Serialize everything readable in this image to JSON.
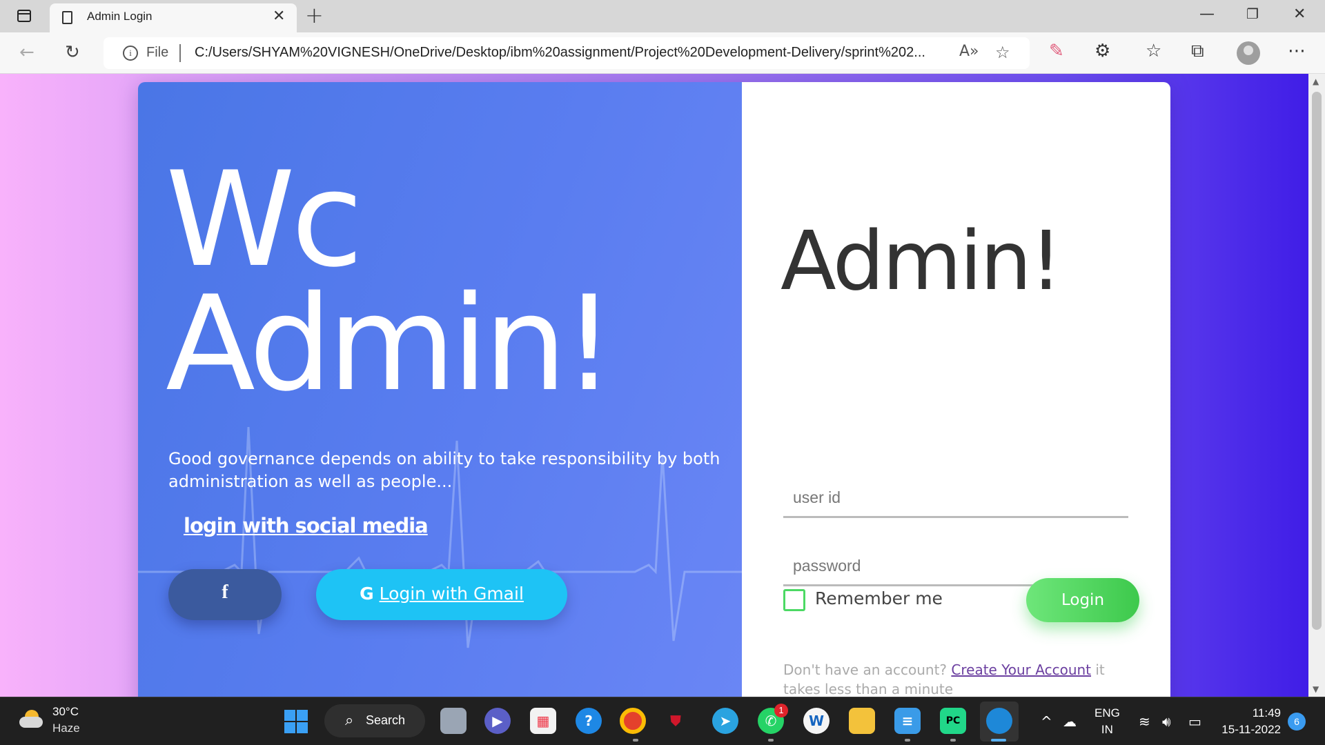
{
  "browser": {
    "tab_title": "Admin Login",
    "address": {
      "scheme_label": "File",
      "url": "C:/Users/SHYAM%20VIGNESH/OneDrive/Desktop/ibm%20assignment/Project%20Development-Delivery/sprint%202..."
    }
  },
  "hero": {
    "title_line1": "Wc",
    "title_line2": "Admin!",
    "tagline": "Good governance depends on ability to take responsibility by both administration as well as people...",
    "social_link": "login with social media",
    "facebook_label": "f",
    "gmail_g": "G",
    "gmail_label": "Login with Gmail"
  },
  "login": {
    "title": "Admin!",
    "userid_placeholder": "user id",
    "password_placeholder": "password",
    "remember_label": "Remember me",
    "login_button": "Login",
    "signup_text_before": "Don't have an account?",
    "signup_link": "Create Your Account",
    "signup_text_after": "it takes less than a minute"
  },
  "taskbar": {
    "weather_temp": "30°C",
    "weather_cond": "Haze",
    "search_label": "Search",
    "whatsapp_badge": "1",
    "lang_line1": "ENG",
    "lang_line2": "IN",
    "time": "11:49",
    "date": "15-11-2022",
    "notifications": "6"
  },
  "colors": {
    "hero_blue": "#4a76e6",
    "facebook": "#3b5a9e",
    "gmail": "#1ec3f5",
    "login_green": "#3dc94c",
    "link_purple": "#6b3fa0"
  }
}
